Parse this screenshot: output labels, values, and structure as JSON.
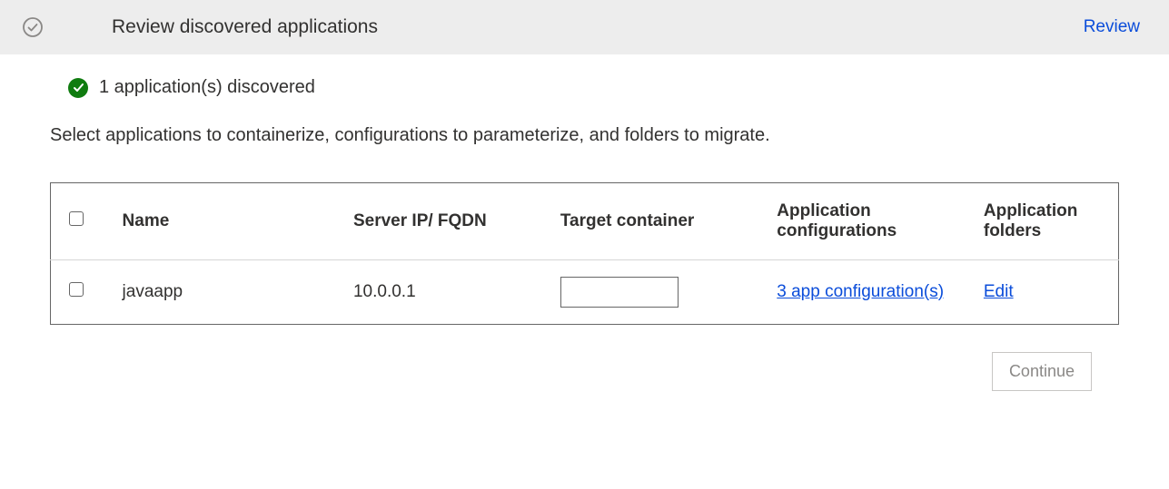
{
  "header": {
    "title": "Review discovered applications",
    "action_label": "Review"
  },
  "status": {
    "count_text": "1 application(s) discovered"
  },
  "instruction": "Select applications to containerize, configurations to parameterize, and folders to migrate.",
  "table": {
    "headers": {
      "name": "Name",
      "server": "Server IP/ FQDN",
      "target": "Target container",
      "config": "Application configurations",
      "folders": "Application folders"
    },
    "rows": [
      {
        "name": "javaapp",
        "server": "10.0.0.1",
        "target_value": "",
        "config_link": "3 app configuration(s)",
        "folders_link": "Edit"
      }
    ]
  },
  "footer": {
    "continue_label": "Continue"
  }
}
